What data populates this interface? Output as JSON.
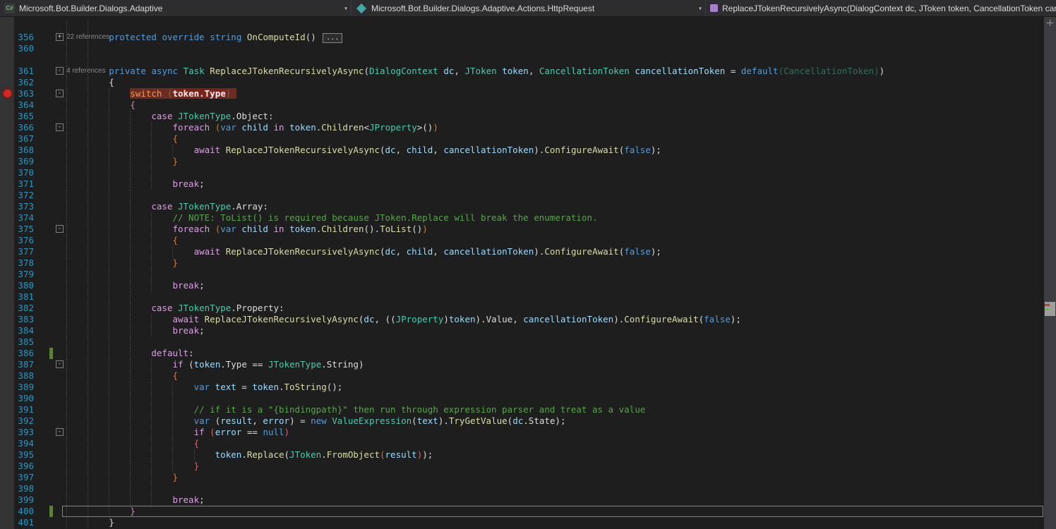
{
  "navbar": {
    "dropdowns": [
      {
        "id": "project",
        "icon": "csharp-project-icon",
        "label": "Microsoft.Bot.Builder.Dialogs.Adaptive"
      },
      {
        "id": "type",
        "icon": "class-icon",
        "label": "Microsoft.Bot.Builder.Dialogs.Adaptive.Actions.HttpRequest"
      },
      {
        "id": "member",
        "icon": "method-icon",
        "label": "ReplaceJTokenRecursivelyAsync(DialogContext dc, JToken token, CancellationToken can"
      }
    ],
    "chevron": "▾"
  },
  "colors": {
    "editor_background": "#1E1E1E",
    "navbar_background": "#2D2D30",
    "keyword": "#569CD6",
    "control_keyword": "#D8A0DF",
    "type": "#4EC9B0",
    "method": "#DCDCAA",
    "variable": "#9CDCFE",
    "comment": "#57A64A",
    "line_number": "#2E96BE",
    "breakpoint": "#D6261D",
    "highlight_background": "#6C2C20",
    "change_tracking_mark": "#5E7F35"
  },
  "editor": {
    "rows": [
      {
        "t": "lens",
        "ind": 8,
        "text": "22 references"
      },
      {
        "t": "code",
        "n": 356,
        "ind": 8,
        "fold": "+",
        "tok": [
          [
            "protected",
            "kw"
          ],
          [
            " ",
            "w"
          ],
          [
            "override",
            "kw"
          ],
          [
            " ",
            "w"
          ],
          [
            "string",
            "kw"
          ],
          [
            " ",
            "w"
          ],
          [
            "OnComputeId",
            "m"
          ],
          [
            "()",
            "w"
          ],
          [
            " ",
            "w"
          ],
          [
            "...",
            "box"
          ]
        ]
      },
      {
        "t": "code",
        "n": 360,
        "ind": 8,
        "tok": []
      },
      {
        "t": "lens",
        "ind": 8,
        "text": "4 references"
      },
      {
        "t": "code",
        "n": 361,
        "ind": 8,
        "fold": "-",
        "tok": [
          [
            "private",
            "kw"
          ],
          [
            " ",
            "w"
          ],
          [
            "async",
            "kw"
          ],
          [
            " ",
            "w"
          ],
          [
            "Task",
            "ty"
          ],
          [
            " ",
            "w"
          ],
          [
            "ReplaceJTokenRecursivelyAsync",
            "m"
          ],
          [
            "(",
            "w"
          ],
          [
            "DialogContext",
            "ty"
          ],
          [
            " ",
            "w"
          ],
          [
            "dc",
            "v"
          ],
          [
            ", ",
            "w"
          ],
          [
            "JToken",
            "ty"
          ],
          [
            " ",
            "w"
          ],
          [
            "token",
            "v"
          ],
          [
            ", ",
            "w"
          ],
          [
            "CancellationToken",
            "ty"
          ],
          [
            " ",
            "w"
          ],
          [
            "cancellationToken",
            "v"
          ],
          [
            " = ",
            "w"
          ],
          [
            "default",
            "kw"
          ],
          [
            "(CancellationToken)",
            "fade"
          ],
          [
            ")",
            "w"
          ]
        ]
      },
      {
        "t": "code",
        "n": 362,
        "ind": 8,
        "tok": [
          [
            "{",
            "w"
          ]
        ]
      },
      {
        "t": "code",
        "n": 363,
        "ind": 12,
        "fold": "-",
        "bp": true,
        "tok": [
          [
            "switch",
            "hlk"
          ],
          [
            " ",
            "hlg"
          ],
          [
            "(",
            "hlg"
          ],
          [
            "token.Type",
            "hlt"
          ],
          [
            ")",
            "hlg"
          ],
          [
            " ",
            "hlg"
          ]
        ]
      },
      {
        "t": "code",
        "n": 364,
        "ind": 12,
        "tok": [
          [
            "{",
            "br2"
          ]
        ]
      },
      {
        "t": "code",
        "n": 365,
        "ind": 16,
        "tok": [
          [
            "case",
            "ctl"
          ],
          [
            " ",
            "w"
          ],
          [
            "JTokenType",
            "ty"
          ],
          [
            ".Object:",
            "w"
          ]
        ]
      },
      {
        "t": "code",
        "n": 366,
        "ind": 20,
        "fold": "-",
        "tok": [
          [
            "foreach",
            "ctl"
          ],
          [
            " ",
            "w"
          ],
          [
            "(",
            "br3"
          ],
          [
            "var",
            "kw"
          ],
          [
            " ",
            "w"
          ],
          [
            "child",
            "v"
          ],
          [
            " ",
            "w"
          ],
          [
            "in",
            "ctl"
          ],
          [
            " ",
            "w"
          ],
          [
            "token",
            "v"
          ],
          [
            ".",
            "w"
          ],
          [
            "Children",
            "m"
          ],
          [
            "<",
            "w"
          ],
          [
            "JProperty",
            "ty"
          ],
          [
            ">()",
            "w"
          ],
          [
            ")",
            "br3"
          ]
        ]
      },
      {
        "t": "code",
        "n": 367,
        "ind": 20,
        "tok": [
          [
            "{",
            "br3"
          ]
        ]
      },
      {
        "t": "code",
        "n": 368,
        "ind": 24,
        "tok": [
          [
            "await",
            "ctl"
          ],
          [
            " ",
            "w"
          ],
          [
            "ReplaceJTokenRecursivelyAsync",
            "m"
          ],
          [
            "(",
            "w"
          ],
          [
            "dc",
            "v"
          ],
          [
            ", ",
            "w"
          ],
          [
            "child",
            "v"
          ],
          [
            ", ",
            "w"
          ],
          [
            "cancellationToken",
            "v"
          ],
          [
            ")",
            "w"
          ],
          [
            ".",
            "w"
          ],
          [
            "ConfigureAwait",
            "m"
          ],
          [
            "(",
            "w"
          ],
          [
            "false",
            "kw"
          ],
          [
            ");",
            "w"
          ]
        ]
      },
      {
        "t": "code",
        "n": 369,
        "ind": 20,
        "tok": [
          [
            "}",
            "br3"
          ]
        ]
      },
      {
        "t": "code",
        "n": 370,
        "ind": 20,
        "tok": []
      },
      {
        "t": "code",
        "n": 371,
        "ind": 20,
        "tok": [
          [
            "break",
            "ctl"
          ],
          [
            ";",
            "w"
          ]
        ]
      },
      {
        "t": "code",
        "n": 372,
        "ind": 16,
        "tok": []
      },
      {
        "t": "code",
        "n": 373,
        "ind": 16,
        "tok": [
          [
            "case",
            "ctl"
          ],
          [
            " ",
            "w"
          ],
          [
            "JTokenType",
            "ty"
          ],
          [
            ".Array:",
            "w"
          ]
        ]
      },
      {
        "t": "code",
        "n": 374,
        "ind": 20,
        "tok": [
          [
            "// NOTE: ToList() is required because JToken.Replace will break the enumeration.",
            "c"
          ]
        ]
      },
      {
        "t": "code",
        "n": 375,
        "ind": 20,
        "fold": "-",
        "tok": [
          [
            "foreach",
            "ctl"
          ],
          [
            " ",
            "w"
          ],
          [
            "(",
            "br3"
          ],
          [
            "var",
            "kw"
          ],
          [
            " ",
            "w"
          ],
          [
            "child",
            "v"
          ],
          [
            " ",
            "w"
          ],
          [
            "in",
            "ctl"
          ],
          [
            " ",
            "w"
          ],
          [
            "token",
            "v"
          ],
          [
            ".",
            "w"
          ],
          [
            "Children",
            "m"
          ],
          [
            "().",
            "w"
          ],
          [
            "ToList",
            "m"
          ],
          [
            "()",
            "w"
          ],
          [
            ")",
            "br3"
          ]
        ]
      },
      {
        "t": "code",
        "n": 376,
        "ind": 20,
        "tok": [
          [
            "{",
            "br3"
          ]
        ]
      },
      {
        "t": "code",
        "n": 377,
        "ind": 24,
        "tok": [
          [
            "await",
            "ctl"
          ],
          [
            " ",
            "w"
          ],
          [
            "ReplaceJTokenRecursivelyAsync",
            "m"
          ],
          [
            "(",
            "w"
          ],
          [
            "dc",
            "v"
          ],
          [
            ", ",
            "w"
          ],
          [
            "child",
            "v"
          ],
          [
            ", ",
            "w"
          ],
          [
            "cancellationToken",
            "v"
          ],
          [
            ")",
            "w"
          ],
          [
            ".",
            "w"
          ],
          [
            "ConfigureAwait",
            "m"
          ],
          [
            "(",
            "w"
          ],
          [
            "false",
            "kw"
          ],
          [
            ");",
            "w"
          ]
        ]
      },
      {
        "t": "code",
        "n": 378,
        "ind": 20,
        "tok": [
          [
            "}",
            "br3"
          ]
        ]
      },
      {
        "t": "code",
        "n": 379,
        "ind": 20,
        "tok": []
      },
      {
        "t": "code",
        "n": 380,
        "ind": 20,
        "tok": [
          [
            "break",
            "ctl"
          ],
          [
            ";",
            "w"
          ]
        ]
      },
      {
        "t": "code",
        "n": 381,
        "ind": 16,
        "tok": []
      },
      {
        "t": "code",
        "n": 382,
        "ind": 16,
        "tok": [
          [
            "case",
            "ctl"
          ],
          [
            " ",
            "w"
          ],
          [
            "JTokenType",
            "ty"
          ],
          [
            ".Property:",
            "w"
          ]
        ]
      },
      {
        "t": "code",
        "n": 383,
        "ind": 20,
        "tok": [
          [
            "await",
            "ctl"
          ],
          [
            " ",
            "w"
          ],
          [
            "ReplaceJTokenRecursivelyAsync",
            "m"
          ],
          [
            "(",
            "w"
          ],
          [
            "dc",
            "v"
          ],
          [
            ", ",
            "w"
          ],
          [
            "((",
            "w"
          ],
          [
            "JProperty",
            "ty"
          ],
          [
            ")",
            "w"
          ],
          [
            "token",
            "v"
          ],
          [
            ").Value",
            "w"
          ],
          [
            ", ",
            "w"
          ],
          [
            "cancellationToken",
            "v"
          ],
          [
            ")",
            "w"
          ],
          [
            ".",
            "w"
          ],
          [
            "ConfigureAwait",
            "m"
          ],
          [
            "(",
            "w"
          ],
          [
            "false",
            "kw"
          ],
          [
            ");",
            "w"
          ]
        ]
      },
      {
        "t": "code",
        "n": 384,
        "ind": 20,
        "tok": [
          [
            "break",
            "ctl"
          ],
          [
            ";",
            "w"
          ]
        ]
      },
      {
        "t": "code",
        "n": 385,
        "ind": 16,
        "tok": []
      },
      {
        "t": "code",
        "n": 386,
        "ind": 16,
        "chg": true,
        "tok": [
          [
            "default",
            "ctl"
          ],
          [
            ":",
            "w"
          ]
        ]
      },
      {
        "t": "code",
        "n": 387,
        "ind": 20,
        "fold": "-",
        "tok": [
          [
            "if",
            "ctl"
          ],
          [
            " ",
            "w"
          ],
          [
            "(",
            "w"
          ],
          [
            "token",
            "v"
          ],
          [
            ".Type",
            "w"
          ],
          [
            " == ",
            "w"
          ],
          [
            "JTokenType",
            "ty"
          ],
          [
            ".String",
            "w"
          ],
          [
            ")",
            "w"
          ]
        ]
      },
      {
        "t": "code",
        "n": 388,
        "ind": 20,
        "tok": [
          [
            "{",
            "br3"
          ]
        ]
      },
      {
        "t": "code",
        "n": 389,
        "ind": 24,
        "tok": [
          [
            "var",
            "kw"
          ],
          [
            " ",
            "w"
          ],
          [
            "text",
            "v"
          ],
          [
            " = ",
            "w"
          ],
          [
            "token",
            "v"
          ],
          [
            ".",
            "w"
          ],
          [
            "ToString",
            "m"
          ],
          [
            "();",
            "w"
          ]
        ]
      },
      {
        "t": "code",
        "n": 390,
        "ind": 24,
        "tok": []
      },
      {
        "t": "code",
        "n": 391,
        "ind": 24,
        "tok": [
          [
            "// if it is a \"{bindingpath}\" then run through expression parser and treat as a value",
            "c"
          ]
        ]
      },
      {
        "t": "code",
        "n": 392,
        "ind": 24,
        "tok": [
          [
            "var",
            "kw"
          ],
          [
            " ",
            "w"
          ],
          [
            "(",
            "w"
          ],
          [
            "result",
            "v"
          ],
          [
            ", ",
            "w"
          ],
          [
            "error",
            "v"
          ],
          [
            ")",
            "w"
          ],
          [
            " = ",
            "w"
          ],
          [
            "new",
            "kw"
          ],
          [
            " ",
            "w"
          ],
          [
            "ValueExpression",
            "ty"
          ],
          [
            "(",
            "w"
          ],
          [
            "text",
            "v"
          ],
          [
            ")",
            "w"
          ],
          [
            ".",
            "w"
          ],
          [
            "TryGetValue",
            "m"
          ],
          [
            "(",
            "w"
          ],
          [
            "dc",
            "v"
          ],
          [
            ".State",
            "w"
          ],
          [
            ");",
            "w"
          ]
        ]
      },
      {
        "t": "code",
        "n": 393,
        "ind": 24,
        "fold": "-",
        "tok": [
          [
            "if",
            "ctl"
          ],
          [
            " ",
            "w"
          ],
          [
            "(",
            "br4"
          ],
          [
            "error",
            "v"
          ],
          [
            " == ",
            "w"
          ],
          [
            "null",
            "kw"
          ],
          [
            ")",
            "br4"
          ]
        ]
      },
      {
        "t": "code",
        "n": 394,
        "ind": 24,
        "tok": [
          [
            "{",
            "br4"
          ]
        ]
      },
      {
        "t": "code",
        "n": 395,
        "ind": 28,
        "tok": [
          [
            "token",
            "v"
          ],
          [
            ".",
            "w"
          ],
          [
            "Replace",
            "m"
          ],
          [
            "(",
            "w"
          ],
          [
            "JToken",
            "ty"
          ],
          [
            ".",
            "w"
          ],
          [
            "FromObject",
            "m"
          ],
          [
            "(",
            "br4"
          ],
          [
            "result",
            "v"
          ],
          [
            ")",
            "br4"
          ],
          [
            ");",
            "w"
          ]
        ]
      },
      {
        "t": "code",
        "n": 396,
        "ind": 24,
        "tok": [
          [
            "}",
            "br4"
          ]
        ]
      },
      {
        "t": "code",
        "n": 397,
        "ind": 20,
        "tok": [
          [
            "}",
            "br3"
          ]
        ]
      },
      {
        "t": "code",
        "n": 398,
        "ind": 20,
        "tok": []
      },
      {
        "t": "code",
        "n": 399,
        "ind": 20,
        "tok": [
          [
            "break",
            "ctl"
          ],
          [
            ";",
            "w"
          ]
        ]
      },
      {
        "t": "code",
        "n": 400,
        "ind": 12,
        "chg": true,
        "outline": true,
        "tok": [
          [
            "}",
            "br2"
          ]
        ]
      },
      {
        "t": "code",
        "n": 401,
        "ind": 8,
        "tok": [
          [
            "}",
            "w"
          ]
        ]
      }
    ]
  }
}
